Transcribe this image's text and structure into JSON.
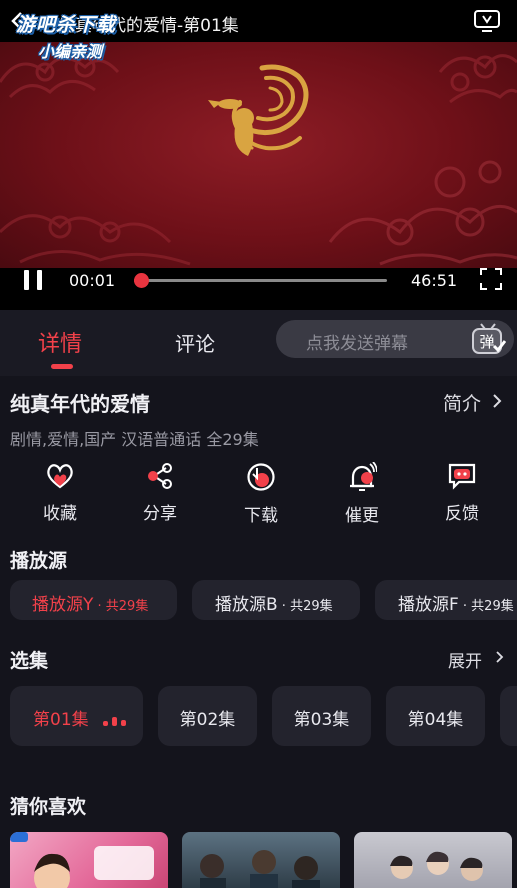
{
  "player": {
    "title": "纯真年代的爱情-第01集",
    "watermark_line1": "游吧杀下载",
    "watermark_line2": "小编亲测",
    "current_time": "00:01",
    "total_time": "46:51",
    "progress": 0.0004
  },
  "tabs": {
    "details": "详情",
    "comments": "评论",
    "danmaku_placeholder": "点我发送弹幕",
    "danmaku_icon_label": "弹"
  },
  "show": {
    "title": "纯真年代的爱情",
    "intro_label": "简介",
    "meta": "剧情,爱情,国产 汉语普通话 全29集"
  },
  "actions": [
    {
      "label": "收藏",
      "icon": "heart-icon"
    },
    {
      "label": "分享",
      "icon": "share-icon"
    },
    {
      "label": "下载",
      "icon": "download-icon"
    },
    {
      "label": "催更",
      "icon": "bell-icon"
    },
    {
      "label": "反馈",
      "icon": "feedback-icon"
    }
  ],
  "sources": {
    "heading": "播放源",
    "items": [
      {
        "name": "播放源Y",
        "count": " · 共29集",
        "active": true
      },
      {
        "name": "播放源B",
        "count": " · 共29集",
        "active": false
      },
      {
        "name": "播放源F",
        "count": " · 共29集",
        "active": false
      }
    ]
  },
  "episodes": {
    "heading": "选集",
    "expand_label": "展开",
    "items": [
      {
        "label": "第01集",
        "active": true
      },
      {
        "label": "第02集",
        "active": false
      },
      {
        "label": "第03集",
        "active": false
      },
      {
        "label": "第04集",
        "active": false
      }
    ]
  },
  "recommend": {
    "heading": "猜你喜欢"
  },
  "colors": {
    "accent": "#f2414a",
    "background": "#14141c",
    "chip": "#23232d",
    "video_red": "#7a131c",
    "gold": "#d9a441"
  }
}
